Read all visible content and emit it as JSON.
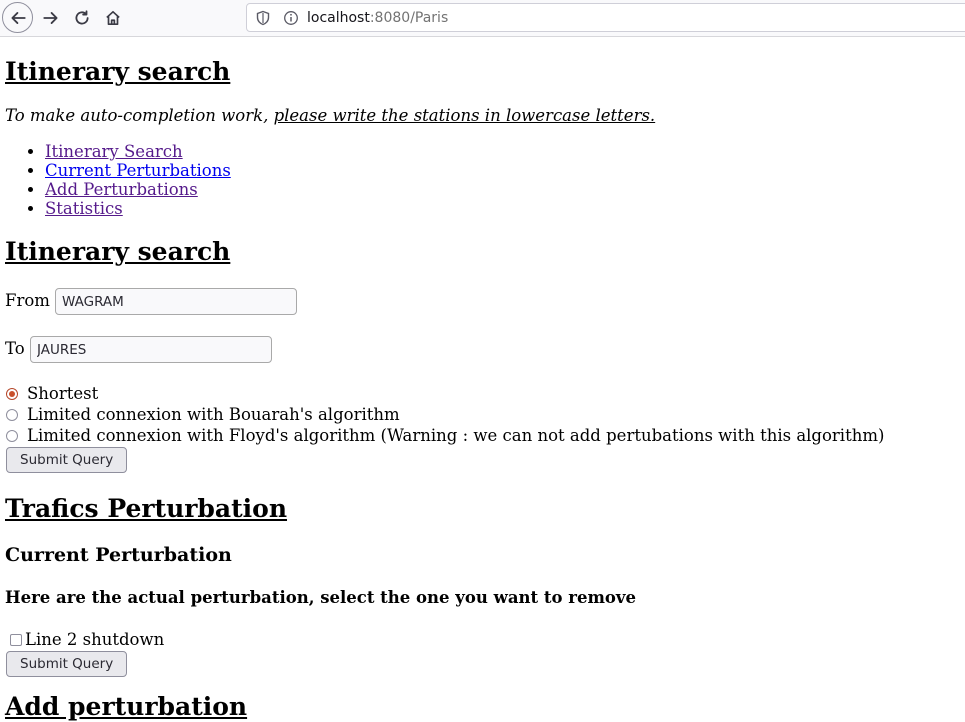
{
  "browser": {
    "url_host": "localhost",
    "url_rest": ":8080/Paris"
  },
  "header": {
    "title": "Itinerary search",
    "note_prefix": "To make auto-completion work, ",
    "note_underlined": "please write the stations in lowercase letters."
  },
  "nav": {
    "items": [
      {
        "label": "Itinerary Search"
      },
      {
        "label": "Current Perturbations"
      },
      {
        "label": "Add Perturbations"
      },
      {
        "label": "Statistics"
      }
    ]
  },
  "itinerary": {
    "title": "Itinerary search",
    "from_label": "From",
    "from_value": "WAGRAM",
    "to_label": "To",
    "to_value": "JAURES",
    "options": [
      {
        "label": "Shortest",
        "checked": true
      },
      {
        "label": "Limited connexion with Bouarah's algorithm",
        "checked": false
      },
      {
        "label": "Limited connexion with Floyd's algorithm (Warning : we can not add pertubations with this algorithm)",
        "checked": false
      }
    ],
    "submit_label": "Submit Query"
  },
  "perturbation": {
    "title": "Trafics Perturbation",
    "current_title": "Current Perturbation",
    "instruction": "Here are the actual perturbation, select the one you want to remove",
    "items": [
      {
        "label": "Line 2 shutdown",
        "checked": false
      }
    ],
    "submit_label": "Submit Query",
    "next_title": "Add perturbation"
  }
}
